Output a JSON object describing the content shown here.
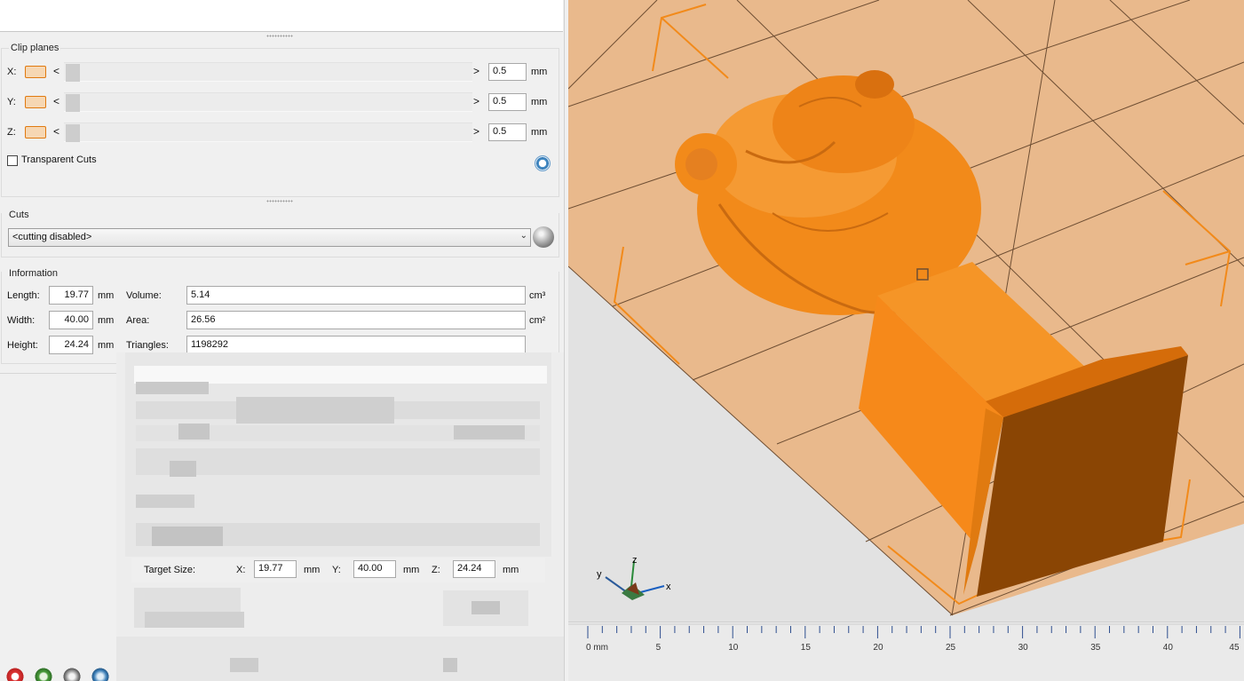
{
  "clip_planes": {
    "title": "Clip planes",
    "axes": [
      {
        "label": "X:",
        "value": "0.5",
        "unit": "mm"
      },
      {
        "label": "Y:",
        "value": "0.5",
        "unit": "mm"
      },
      {
        "label": "Z:",
        "value": "0.5",
        "unit": "mm"
      }
    ],
    "arrow_left": "<",
    "arrow_right": ">",
    "transparent_cuts_label": "Transparent Cuts",
    "transparent_cuts_checked": false
  },
  "cuts": {
    "title": "Cuts",
    "selected": "<cutting disabled>"
  },
  "information": {
    "title": "Information",
    "length_label": "Length:",
    "length": "19.77",
    "width_label": "Width:",
    "width": "40.00",
    "height_label": "Height:",
    "height": "24.24",
    "unit_mm": "mm",
    "volume_label": "Volume:",
    "volume": "5.14",
    "volume_unit": "cm³",
    "area_label": "Area:",
    "area": "26.56",
    "area_unit": "cm²",
    "triangles_label": "Triangles:",
    "triangles": "1198292"
  },
  "target_size": {
    "label": "Target Size:",
    "x_label": "X:",
    "x": "19.77",
    "y_label": "Y:",
    "y": "40.00",
    "z_label": "Z:",
    "z": "24.24",
    "unit": "mm"
  },
  "axis_triad": {
    "x": "x",
    "y": "y",
    "z": "z"
  },
  "ruler": {
    "ticks": [
      "0 mm",
      "5",
      "10",
      "15",
      "20",
      "25",
      "30",
      "35",
      "40",
      "45"
    ]
  },
  "colors": {
    "model_orange": "#f28a1a",
    "plate": "#e9b98c",
    "grid_line": "#6e4e33",
    "accent_orange": "#e07a10"
  }
}
